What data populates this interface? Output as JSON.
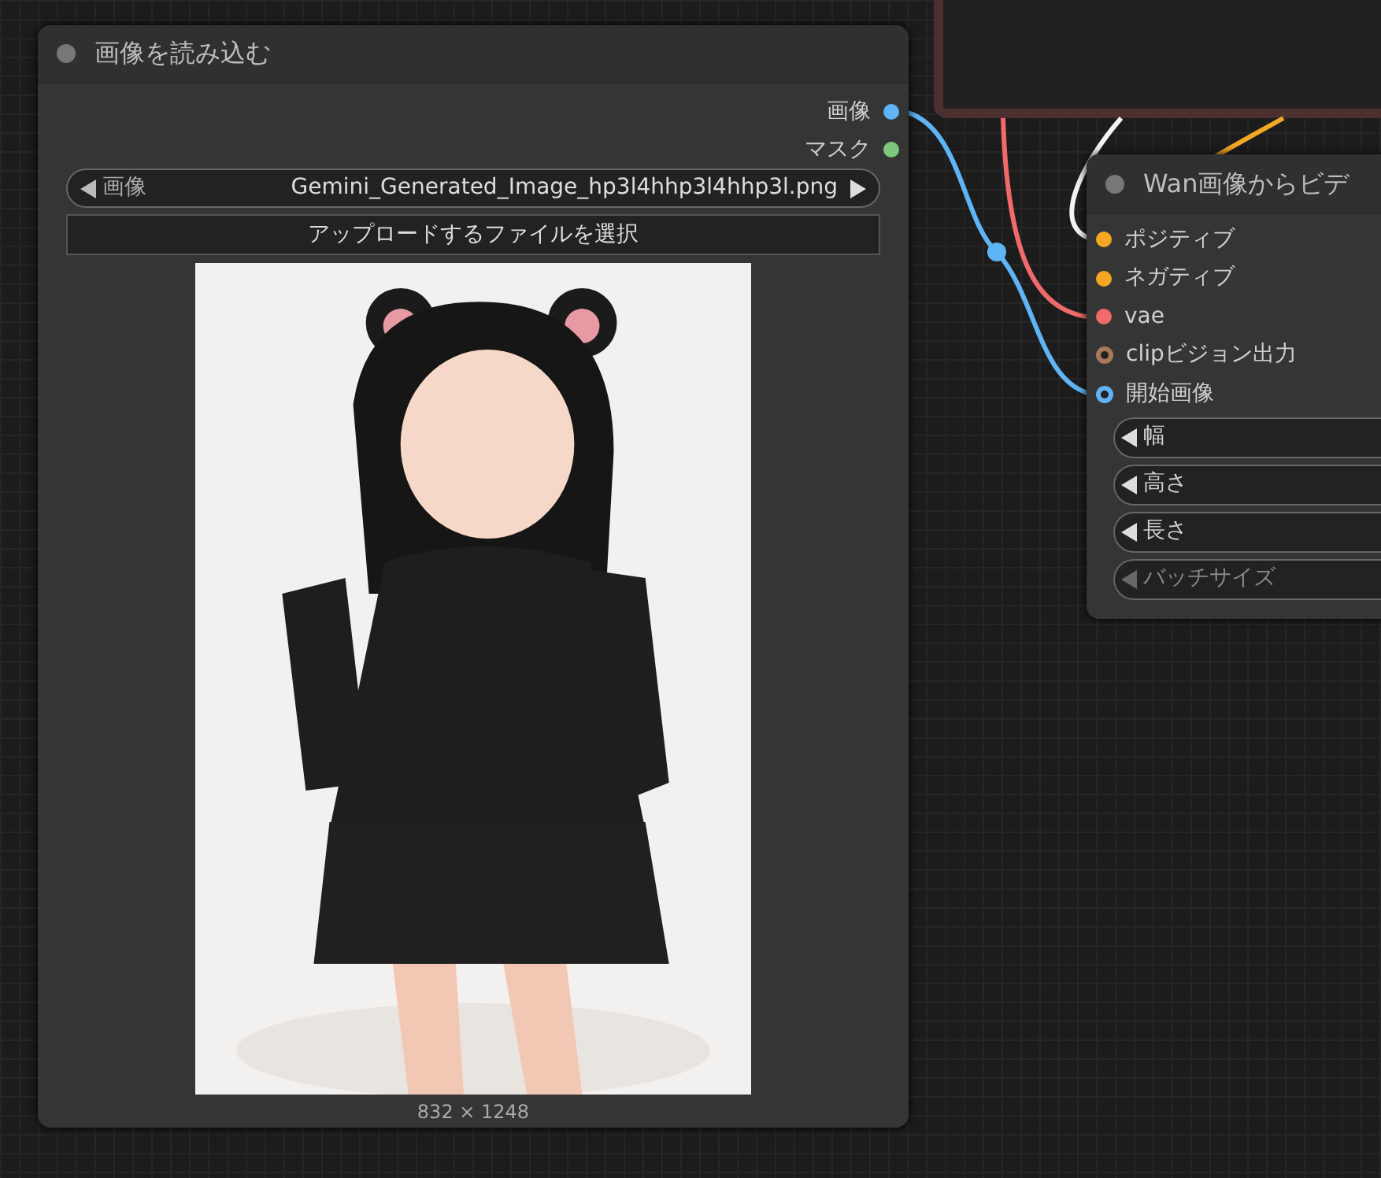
{
  "load_image_node": {
    "title": "画像を読み込む",
    "outputs": [
      {
        "label": "画像",
        "color": "#5fb4f5"
      },
      {
        "label": "マスク",
        "color": "#7ec87e"
      }
    ],
    "image_widget": {
      "label": "画像",
      "value": "Gemini_Generated_Image_hp3l4hhp3l4hhp3l.png"
    },
    "upload_button": "アップロードするファイルを選択",
    "dimensions": "832 × 1248"
  },
  "wan_node": {
    "title": "Wan画像からビデ",
    "inputs": [
      {
        "label": "ポジティブ",
        "color": "#f5a623",
        "optional": false
      },
      {
        "label": "ネガティブ",
        "color": "#f5a623",
        "optional": false
      },
      {
        "label": "vae",
        "color": "#f06a6a",
        "optional": false
      },
      {
        "label": "clipビジョン出力",
        "color": "#a8785a",
        "optional": true
      },
      {
        "label": "開始画像",
        "color": "#5fb4f5",
        "optional": true
      }
    ],
    "widgets": [
      {
        "label": "幅",
        "disabled": false
      },
      {
        "label": "高さ",
        "disabled": false
      },
      {
        "label": "長さ",
        "disabled": false
      },
      {
        "label": "バッチサイズ",
        "disabled": true
      }
    ]
  }
}
